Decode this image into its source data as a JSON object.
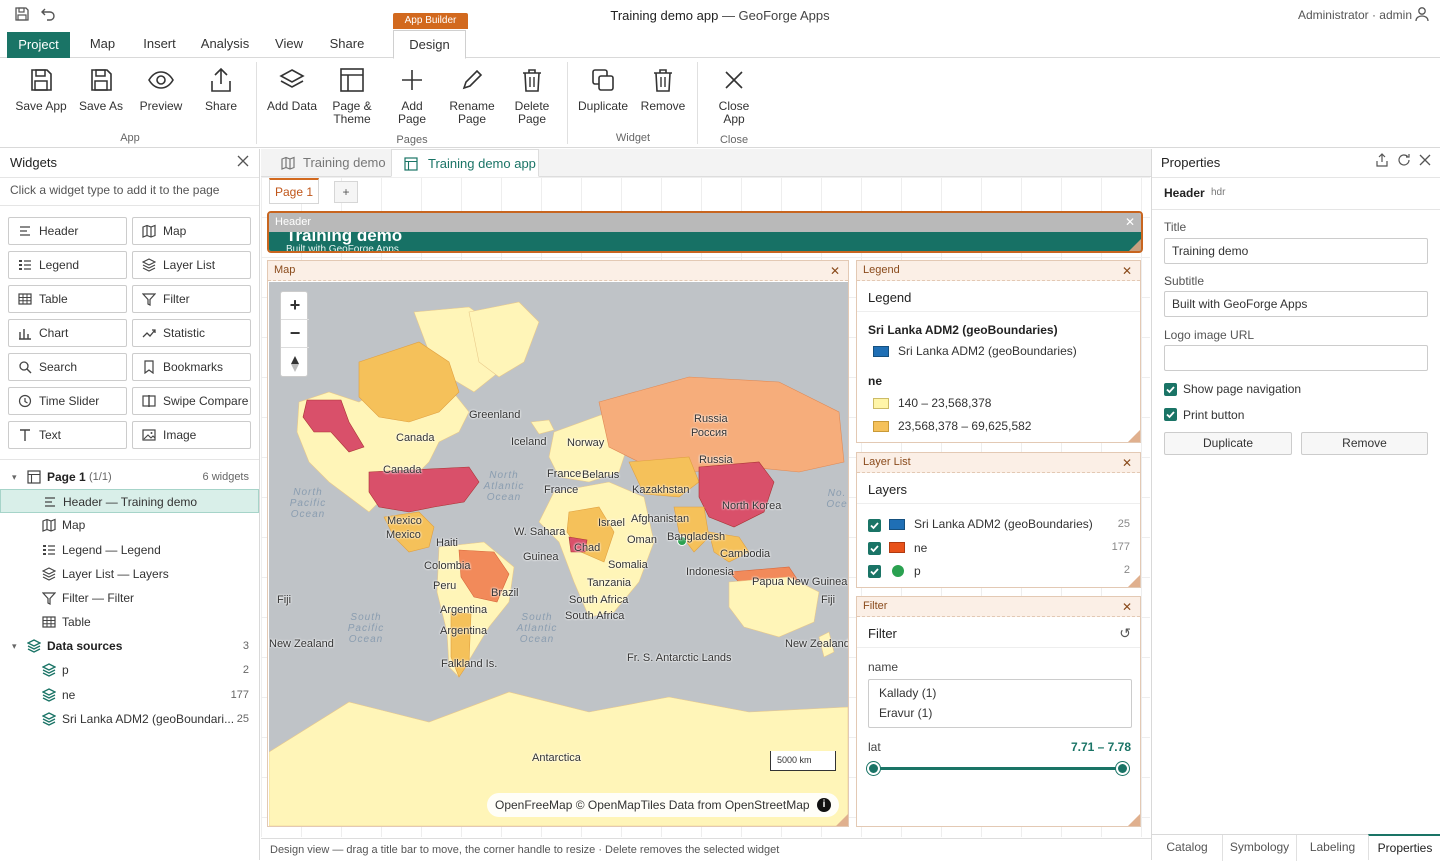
{
  "titlebar": {
    "app_name": "Training demo app",
    "suffix": "— GeoForge Apps",
    "user": "Administrator · admin"
  },
  "ribbon_tabs": [
    "Project",
    "Map",
    "Insert",
    "Analysis",
    "View",
    "Share"
  ],
  "context": {
    "group": "App Builder",
    "tab": "Design"
  },
  "ribbon": {
    "app": {
      "label": "App",
      "buttons": [
        "Save App",
        "Save As",
        "Preview",
        "Share"
      ]
    },
    "pages": {
      "label": "Pages",
      "buttons": [
        "Add Data",
        "Page & Theme",
        "Add Page",
        "Rename Page",
        "Delete Page"
      ]
    },
    "widget": {
      "label": "Widget",
      "buttons": [
        "Duplicate",
        "Remove"
      ]
    },
    "close": {
      "label": "Close",
      "buttons": [
        "Close App"
      ]
    }
  },
  "widgets_panel": {
    "title": "Widgets",
    "hint": "Click a widget type to add it to the page",
    "types": [
      "Header",
      "Map",
      "Legend",
      "Layer List",
      "Table",
      "Filter",
      "Chart",
      "Statistic",
      "Search",
      "Bookmarks",
      "Time Slider",
      "Swipe Compare",
      "Text",
      "Image"
    ],
    "page": {
      "name": "Page 1",
      "sub": "(1/1)",
      "count": "6 widgets"
    },
    "page_items": [
      "Header — Training demo",
      "Map",
      "Legend — Legend",
      "Layer List — Layers",
      "Filter — Filter",
      "Table"
    ],
    "sources": {
      "label": "Data sources",
      "count": "3",
      "items": [
        {
          "name": "p",
          "count": "2"
        },
        {
          "name": "ne",
          "count": "177"
        },
        {
          "name": "Sri Lanka ADM2 (geoBoundari...",
          "count": "25"
        }
      ]
    }
  },
  "doc_tabs": [
    "Training demo",
    "Training demo app"
  ],
  "page_tabs": {
    "active": "Page 1",
    "add": "+"
  },
  "header_widget": {
    "tag": "Header",
    "title": "Training demo",
    "subtitle": "Built with GeoForge Apps"
  },
  "map_widget": {
    "tag": "Map",
    "scale": "5000 km",
    "attribution": "OpenFreeMap © OpenMapTiles Data from OpenStreetMap",
    "zoom_in": "+",
    "zoom_out": "−"
  },
  "map_labels": [
    "Greenland",
    "Canada",
    "Canada",
    "Iceland",
    "Norway",
    "Russia",
    "Россия",
    "Russia",
    "Belarus",
    "France",
    "France",
    "Kazakhstan",
    "Mexico",
    "Mexico",
    "Israel",
    "Afghanistan",
    "North Korea",
    "W. Sahara",
    "Haiti",
    "Oman",
    "Bangladesh",
    "Guinea",
    "Chad",
    "Colombia",
    "Somalia",
    "Cambodia",
    "Indonesia",
    "Tanzania",
    "Papua New Guinea",
    "Peru",
    "Brazil",
    "Fiji",
    "Fiji",
    "South Africa",
    "South Africa",
    "Argentina",
    "Argentina",
    "New Zealand",
    "New Zealand",
    "Falkland Is.",
    "Fr. S. Antarctic Lands",
    "Antarctica"
  ],
  "ocean_labels": [
    "North Pacific Ocean",
    "North Atlantic Ocean",
    "South Pacific Ocean",
    "South Atlantic Ocean",
    "No. Oce"
  ],
  "legend_widget": {
    "tag": "Legend",
    "heading": "Legend",
    "layer1": "Sri Lanka ADM2 (geoBoundaries)",
    "layer1_item": "Sri Lanka ADM2 (geoBoundaries)",
    "layer2": "ne",
    "classes": [
      {
        "label": "140 – 23,568,378",
        "color": "#fff5a8"
      },
      {
        "label": "23,568,378 – 69,625,582",
        "color": "#f5c15a"
      }
    ]
  },
  "layerlist_widget": {
    "tag": "Layer List",
    "heading": "Layers",
    "layers": [
      {
        "name": "Sri Lanka ADM2 (geoBoundaries)",
        "count": "25",
        "color": "#1f6fb5"
      },
      {
        "name": "ne",
        "count": "177",
        "color": "#e8521a"
      },
      {
        "name": "p",
        "count": "2",
        "color": "#2aa150"
      }
    ]
  },
  "filter_widget": {
    "tag": "Filter",
    "heading": "Filter",
    "field1": "name",
    "values": [
      "Kallady (1)",
      "Eravur (1)"
    ],
    "field2": "lat",
    "range": "7.71 – 7.78",
    "range_fraction": [
      0,
      1
    ]
  },
  "properties": {
    "title": "Properties",
    "widget": "Header",
    "widget_id": "hdr",
    "title_label": "Title",
    "title_value": "Training demo",
    "subtitle_label": "Subtitle",
    "subtitle_value": "Built with GeoForge Apps",
    "logo_label": "Logo image URL",
    "logo_value": "",
    "check1": "Show page navigation",
    "check2": "Print button",
    "duplicate": "Duplicate",
    "remove": "Remove"
  },
  "bottom_tabs": [
    "Catalog",
    "Symbology",
    "Labeling",
    "Properties"
  ],
  "status": "Design view — drag a title bar to move, the corner handle to resize · Delete removes the selected widget",
  "colors": {
    "accent": "#1a7466",
    "context": "#d2691e"
  }
}
